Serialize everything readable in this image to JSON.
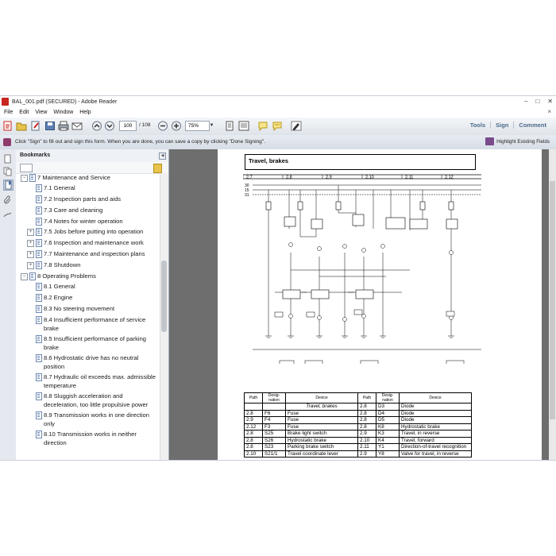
{
  "window": {
    "title": "BAL_001.pdf (SECURED) - Adobe Reader"
  },
  "menu": [
    "File",
    "Edit",
    "View",
    "Window",
    "Help"
  ],
  "toolbar": {
    "page_value": "100",
    "page_total": "/ 108",
    "zoom_value": "75%",
    "right_links": [
      "Tools",
      "Sign",
      "Comment"
    ]
  },
  "signbar": {
    "message": "Click \"Sign\" to fill out and sign this form. When you are done, you can save a copy by clicking \"Done Signing\".",
    "highlight_label": "Highlight Existing Fields"
  },
  "bookmarks": {
    "title": "Bookmarks",
    "items": [
      {
        "label": "7 Maintenance and Service",
        "level": 0,
        "expand": "-"
      },
      {
        "label": "7.1 General",
        "level": 1,
        "expand": ""
      },
      {
        "label": "7.2 Inspection parts and aids",
        "level": 1,
        "expand": ""
      },
      {
        "label": "7.3 Care and cleaning",
        "level": 1,
        "expand": ""
      },
      {
        "label": "7.4 Notes for winter operation",
        "level": 1,
        "expand": ""
      },
      {
        "label": "7.5 Jobs before putting into operation",
        "level": 1,
        "expand": "+"
      },
      {
        "label": "7.6 Inspection and maintenance work",
        "level": 1,
        "expand": "+"
      },
      {
        "label": "7.7 Maintenance and inspection plans",
        "level": 1,
        "expand": "+"
      },
      {
        "label": "7.8 Shutdown",
        "level": 1,
        "expand": "+"
      },
      {
        "label": "8 Operating Problems",
        "level": 0,
        "expand": "-"
      },
      {
        "label": "8.1 General",
        "level": 1,
        "expand": ""
      },
      {
        "label": "8.2 Engine",
        "level": 1,
        "expand": ""
      },
      {
        "label": "8.3 No steering movement",
        "level": 1,
        "expand": ""
      },
      {
        "label": "8.4 Insufficient performance of service brake",
        "level": 1,
        "expand": ""
      },
      {
        "label": "8.5 Insufficient performance of parking brake",
        "level": 1,
        "expand": ""
      },
      {
        "label": "8.6 Hydrostatic drive has no neutral position",
        "level": 1,
        "expand": ""
      },
      {
        "label": "8.7 Hydraulic oil exceeds max. admissible temperature",
        "level": 1,
        "expand": ""
      },
      {
        "label": "8.8 Sluggish acceleration and deceleration, too little propulsive power",
        "level": 1,
        "expand": ""
      },
      {
        "label": "8.9 Transmission works in one direction only",
        "level": 1,
        "expand": ""
      },
      {
        "label": "8.10 Transmission works in neither direction",
        "level": 1,
        "expand": ""
      }
    ]
  },
  "page": {
    "title": "Travel, brakes",
    "paths": [
      "2.7",
      "2.8",
      "2.9",
      "2.10",
      "2.11",
      "2.12"
    ],
    "table_headers": [
      "Path",
      "Desig-\nnation",
      "Device"
    ],
    "table_section": "Travel, brakes",
    "left_rows": [
      [
        "2.8",
        "F6",
        "Fuse"
      ],
      [
        "2.9",
        "F4",
        "Fuse"
      ],
      [
        "2.12",
        "F3",
        "Fuse"
      ],
      [
        "2.8",
        "S25",
        "Brake light switch"
      ],
      [
        "2.8",
        "S26",
        "Hydrostatic brake"
      ],
      [
        "2.8",
        "S23",
        "Parking brake switch"
      ],
      [
        "2.10",
        "S21/1",
        "Travel coordinate lever"
      ]
    ],
    "right_rows": [
      [
        "2.8",
        "D3",
        "Diode"
      ],
      [
        "2.8",
        "D4",
        "Diode"
      ],
      [
        "2.8",
        "D5",
        "Diode"
      ],
      [
        "2.8",
        "K8",
        "Hydrostatic brake"
      ],
      [
        "2.9",
        "K3",
        "Travel, in reverse"
      ],
      [
        "2.10",
        "K4",
        "Travel, forward"
      ],
      [
        "2.11",
        "Y1",
        "Direction-of-travel recognition"
      ],
      [
        "2.9",
        "Y8",
        "Valve for travel, in reverse"
      ]
    ]
  }
}
